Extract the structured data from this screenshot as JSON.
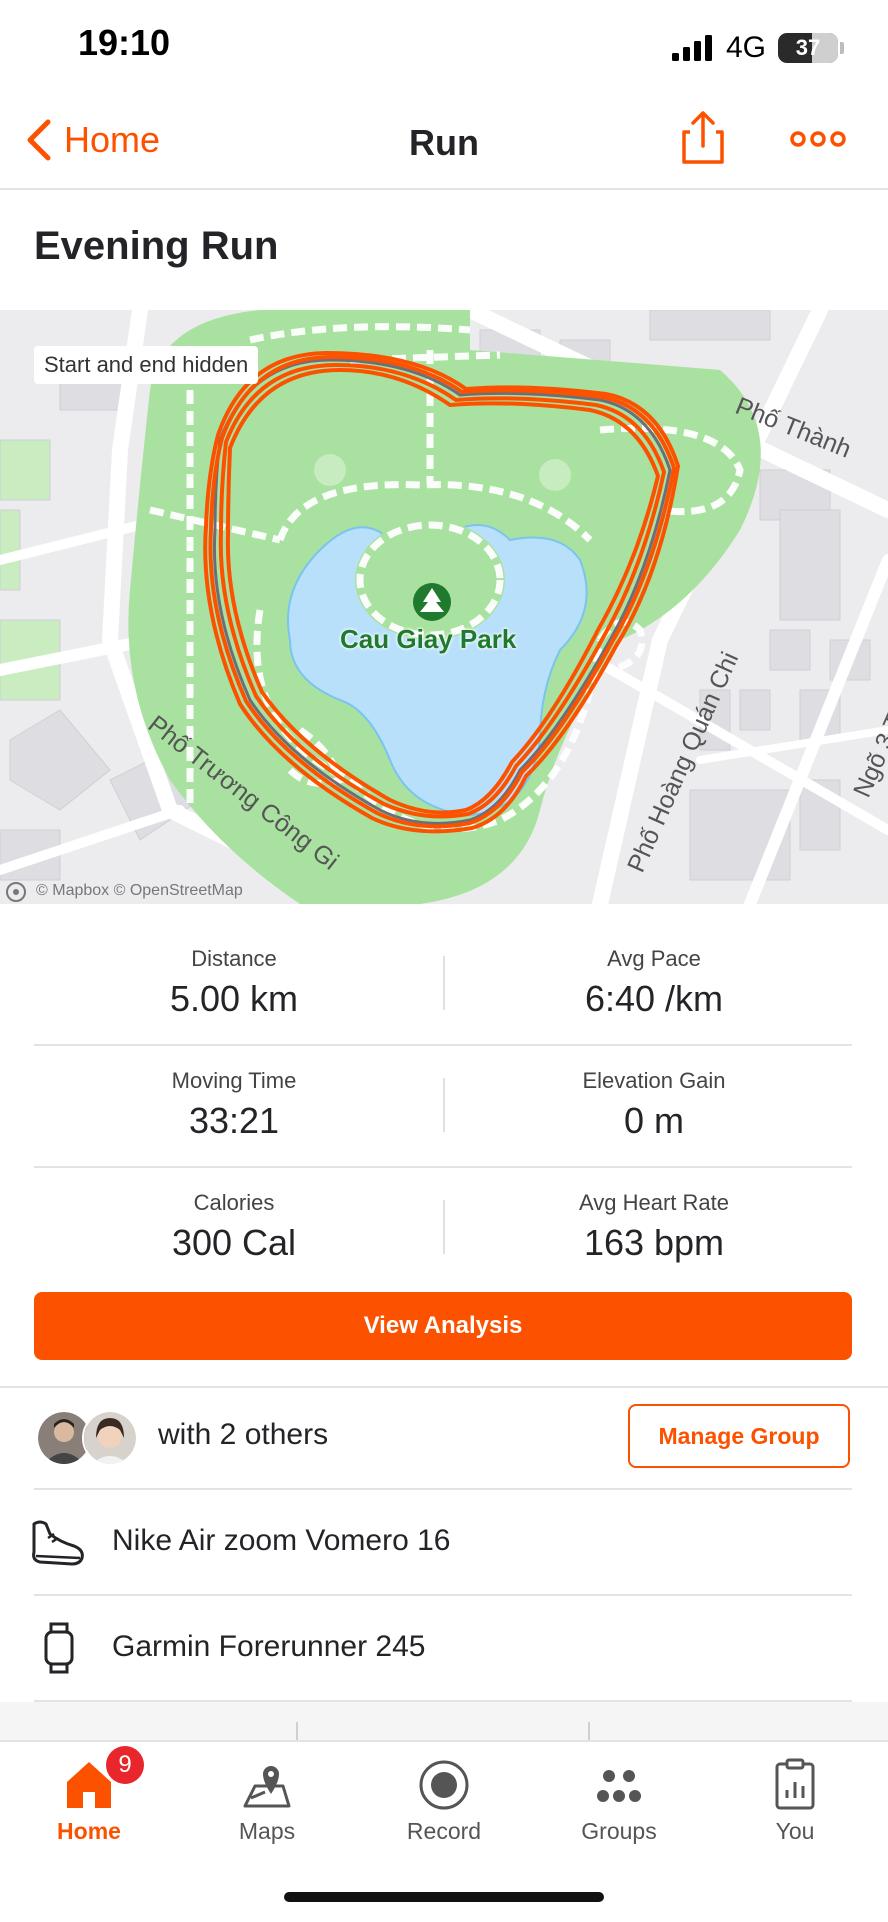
{
  "status_bar": {
    "time": "19:10",
    "network": "4G",
    "battery": "37"
  },
  "nav": {
    "back_label": "Home",
    "title": "Run"
  },
  "activity": {
    "title": "Evening Run"
  },
  "map": {
    "badge": "Start and end hidden",
    "poi": "Cau Giay Park",
    "streets": [
      "Phố Thành",
      "Phố Trương Công Gi",
      "Phố Hoàng Quán Chi",
      "Ngõ 3 Th"
    ],
    "attribution": "© Mapbox © OpenStreetMap",
    "route_color": "#fc5200",
    "water_color": "#b9e0fa",
    "park_color": "#a9e2a0"
  },
  "stats": [
    {
      "label": "Distance",
      "value": "5.00 km"
    },
    {
      "label": "Avg Pace",
      "value": "6:40 /km"
    },
    {
      "label": "Moving Time",
      "value": "33:21"
    },
    {
      "label": "Elevation Gain",
      "value": "0 m"
    },
    {
      "label": "Calories",
      "value": "300 Cal"
    },
    {
      "label": "Avg Heart Rate",
      "value": "163 bpm"
    }
  ],
  "analysis_button": "View Analysis",
  "group": {
    "text": "with 2 others",
    "manage_label": "Manage Group"
  },
  "gear": {
    "shoes": "Nike Air zoom Vomero 16",
    "device": "Garmin Forerunner 245"
  },
  "tabs": [
    {
      "label": "Home",
      "icon": "home-icon",
      "active": true,
      "badge": "9"
    },
    {
      "label": "Maps",
      "icon": "maps-icon"
    },
    {
      "label": "Record",
      "icon": "record-icon"
    },
    {
      "label": "Groups",
      "icon": "groups-icon"
    },
    {
      "label": "You",
      "icon": "you-icon"
    }
  ],
  "colors": {
    "accent": "#fc5200",
    "badge": "#e8262b"
  }
}
